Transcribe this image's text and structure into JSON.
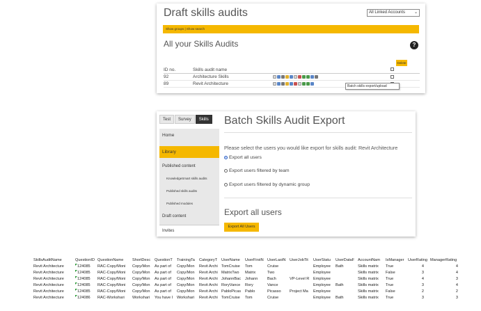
{
  "panel1": {
    "title": "Draft skills audits",
    "account_select": "All Linked Accounts",
    "bar_links": "Show groups | Show search",
    "subtitle": "All your Skills Audits",
    "help": "?",
    "delete_label": "Delete",
    "headers": {
      "id": "ID no.",
      "name": "Skills audit name"
    },
    "rows": [
      {
        "id": "92",
        "name": "Architecture Skills"
      },
      {
        "id": "89",
        "name": "Revit Architecture"
      }
    ],
    "tooltip": "Batch skills export/upload"
  },
  "panel2": {
    "tabs": [
      "Test",
      "Survey",
      "Skills"
    ],
    "sidebar": {
      "home": "Home",
      "library": "Library",
      "published_content": "Published content",
      "knowledgesmart": "KnowledgeSmart skills audits",
      "published_skills": "Published skills audits",
      "published_modules": "Published modules",
      "draft": "Draft content",
      "invites": "Invites"
    },
    "title": "Batch Skills Audit Export",
    "prompt": "Please select the users you would like export for skills audit: Revit Architecture",
    "options": [
      "Export all users",
      "Export users filtered by team",
      "Export users filtered by dynamic group"
    ],
    "section_title": "Export all users",
    "button_label": "Export All Users"
  },
  "sheet": {
    "headers": [
      "SkillsAuditName",
      "QuestionID",
      "QuestionName",
      "ShortDesc",
      "QuestionT",
      "TrainingTa",
      "CategoryT",
      "UserName",
      "UserFirstN",
      "UserLastN",
      "UserJobTit",
      "UserStatu",
      "UserDataF",
      "AccountNam",
      "IsManager",
      "UserRating",
      "ManagerRating"
    ],
    "rows": [
      [
        "Revit Architecture",
        "124085",
        "RAC-Copy/Moni",
        "Copy/Mon",
        "As part of",
        "Copy/Mon",
        "Revit Archi",
        "TomCruise",
        "Tom",
        "Cruise",
        "",
        "Employee",
        "Bath",
        "Skills matrix",
        "True",
        "4",
        "4"
      ],
      [
        "Revit Architecture",
        "124085",
        "RAC-Copy/Moni",
        "Copy/Mon",
        "As part of",
        "Copy/Mon",
        "Revit Archi",
        "MatrixTwo",
        "Matrix",
        "Two",
        "",
        "Employee",
        "",
        "Skills matrix",
        "False",
        "3",
        "4"
      ],
      [
        "Revit Architecture",
        "124085",
        "RAC-Copy/Moni",
        "Copy/Mon",
        "As part of",
        "Copy/Mon",
        "Revit Archi",
        "JohannBac",
        "Johann",
        "Bach",
        "VP-Level R",
        "Employee",
        "",
        "Skills matrix",
        "True",
        "4",
        "3"
      ],
      [
        "Revit Architecture",
        "124085",
        "RAC-Copy/Moni",
        "Copy/Mon",
        "As part of",
        "Copy/Mon",
        "Revit Archi",
        "RoryVance",
        "Rory",
        "Vance",
        "",
        "Employee",
        "Bath",
        "Skills matrix",
        "True",
        "3",
        "4"
      ],
      [
        "Revit Architecture",
        "124085",
        "RAC-Copy/Moni",
        "Copy/Mon",
        "As part of",
        "Copy/Mon",
        "Revit Archi",
        "PabloPicas",
        "Pablo",
        "Picasso",
        "Project Ma",
        "Employee",
        "",
        "Skills matrix",
        "False",
        "2",
        "2"
      ],
      [
        "Revit Architecture",
        "124086",
        "RAC-Workshari",
        "Workshari",
        "You have I",
        "Workshari",
        "Revit Archi",
        "TomCruise",
        "Tom",
        "Cruise",
        "",
        "Employee",
        "Bath",
        "Skills matrix",
        "True",
        "3",
        "3"
      ]
    ]
  },
  "colors": {
    "accent": "#f5b800",
    "dark_tab": "#333333",
    "sidebar_bg": "#e8e8e8"
  }
}
